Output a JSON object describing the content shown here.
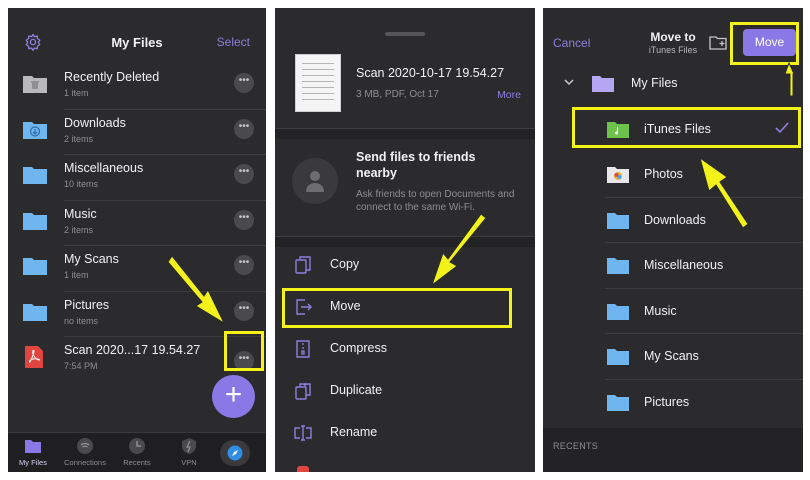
{
  "panel1": {
    "title": "My Files",
    "select_label": "Select",
    "files": [
      {
        "name": "Recently Deleted",
        "sub": "1 item",
        "icon": "trash-folder-icon"
      },
      {
        "name": "Downloads",
        "sub": "2 items",
        "icon": "downloads-folder-icon"
      },
      {
        "name": "Miscellaneous",
        "sub": "10 items",
        "icon": "folder-icon"
      },
      {
        "name": "Music",
        "sub": "2 items",
        "icon": "folder-icon"
      },
      {
        "name": "My Scans",
        "sub": "1 item",
        "icon": "folder-icon"
      },
      {
        "name": "Pictures",
        "sub": "no items",
        "icon": "folder-icon"
      },
      {
        "name": "Scan 2020...17 19.54.27",
        "sub": "7:54 PM",
        "icon": "pdf-icon"
      }
    ],
    "more_glyph": "•••",
    "fab_glyph": "+",
    "tabs": [
      {
        "label": "My Files",
        "icon": "folder-icon"
      },
      {
        "label": "Connections",
        "icon": "connections-icon"
      },
      {
        "label": "Recents",
        "icon": "clock-icon"
      },
      {
        "label": "VPN",
        "icon": "vpn-shield-icon"
      }
    ]
  },
  "panel2": {
    "doc_name": "Scan 2020-10-17 19.54.27",
    "doc_meta": "3 MB, PDF, Oct 17",
    "more_label": "More",
    "share_title": "Send files to friends nearby",
    "share_desc": "Ask friends to open Documents and connect to the same Wi-Fi.",
    "actions": [
      {
        "label": "Copy",
        "icon": "copy-icon"
      },
      {
        "label": "Move",
        "icon": "move-icon"
      },
      {
        "label": "Compress",
        "icon": "compress-icon"
      },
      {
        "label": "Duplicate",
        "icon": "duplicate-icon"
      },
      {
        "label": "Rename",
        "icon": "rename-icon"
      }
    ]
  },
  "panel3": {
    "cancel_label": "Cancel",
    "title": "Move to",
    "subtitle": "iTunes Files",
    "move_label": "Move",
    "root": "My Files",
    "destinations": [
      {
        "label": "iTunes Files",
        "icon": "itunes-folder-icon",
        "selected": true
      },
      {
        "label": "Photos",
        "icon": "photos-icon",
        "selected": false
      },
      {
        "label": "Downloads",
        "icon": "folder-icon",
        "selected": false
      },
      {
        "label": "Miscellaneous",
        "icon": "folder-icon",
        "selected": false
      },
      {
        "label": "Music",
        "icon": "folder-icon",
        "selected": false
      },
      {
        "label": "My Scans",
        "icon": "folder-icon",
        "selected": false
      },
      {
        "label": "Pictures",
        "icon": "folder-icon",
        "selected": false
      }
    ],
    "recents_label": "RECENTS"
  },
  "colors": {
    "accent": "#8a78e6",
    "highlight": "#f3f31a",
    "panel_bg": "#2b2b2d",
    "folder": "#6fb6f0"
  }
}
